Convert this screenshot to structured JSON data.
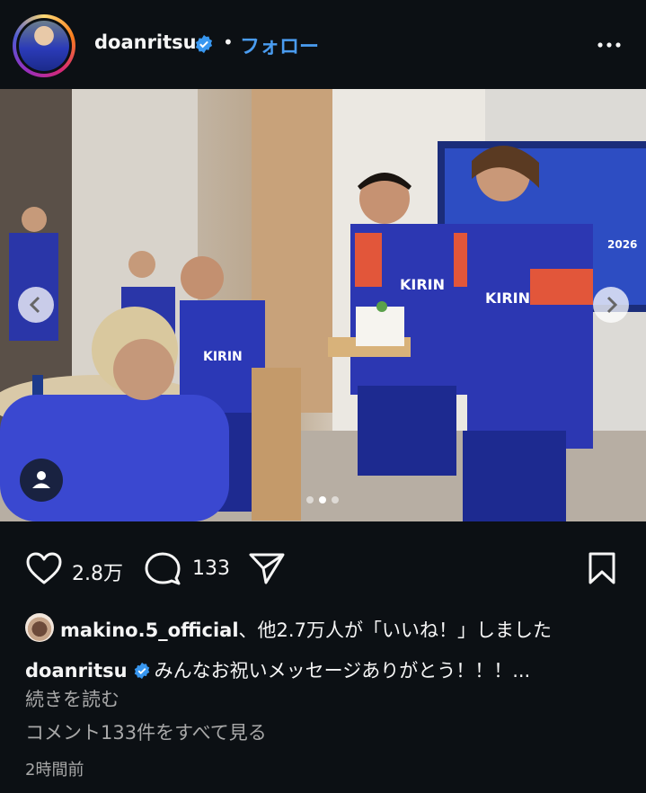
{
  "header": {
    "username": "doanritsu",
    "separator": "•",
    "follow_label": "フォロー"
  },
  "actions": {
    "like_count": "2.8万",
    "comment_count": "133"
  },
  "likes": {
    "liker": "makino.5_official",
    "text": "、他2.7万人が「いいね！」しました"
  },
  "caption": {
    "username": "doanritsu",
    "text": "みんなお祝いメッセージありがとう！！！..."
  },
  "read_more": "続きを読む",
  "view_comments": "コメント133件をすべて見る",
  "time_ago": "2時間前",
  "photo": {
    "jersey_text": "KIRIN",
    "tv_text": "2026",
    "carousel_total": 3,
    "carousel_active": 2
  },
  "colors": {
    "background": "#0c1014",
    "accent_blue": "#4a9cf0",
    "secondary_text": "#a8a8a8",
    "verified": "#3897f0"
  }
}
